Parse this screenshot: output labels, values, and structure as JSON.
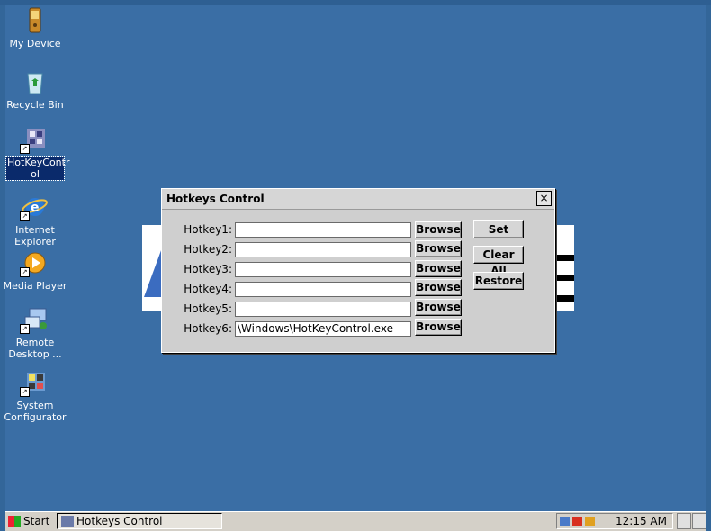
{
  "desktop": {
    "icons": [
      {
        "label": "My Device"
      },
      {
        "label": "Recycle Bin"
      },
      {
        "label": "HotKeyContr ol"
      },
      {
        "label": "Internet Explorer"
      },
      {
        "label": "Media Player"
      },
      {
        "label": "Remote Desktop ..."
      },
      {
        "label": "System Configurator"
      }
    ]
  },
  "dialog": {
    "title": "Hotkeys Control",
    "close_label": "×",
    "hotkeys": [
      {
        "label": "Hotkey1:",
        "value": ""
      },
      {
        "label": "Hotkey2:",
        "value": ""
      },
      {
        "label": "Hotkey3:",
        "value": ""
      },
      {
        "label": "Hotkey4:",
        "value": ""
      },
      {
        "label": "Hotkey5:",
        "value": ""
      },
      {
        "label": "Hotkey6:",
        "value": "\\Windows\\HotKeyControl.exe"
      }
    ],
    "browse_label": "Browse",
    "set_label": "Set",
    "clear_all_label": "Clear All",
    "restore_label": "Restore"
  },
  "taskbar": {
    "start_label": "Start",
    "task_item_label": "Hotkeys Control",
    "clock": "12:15 AM"
  }
}
